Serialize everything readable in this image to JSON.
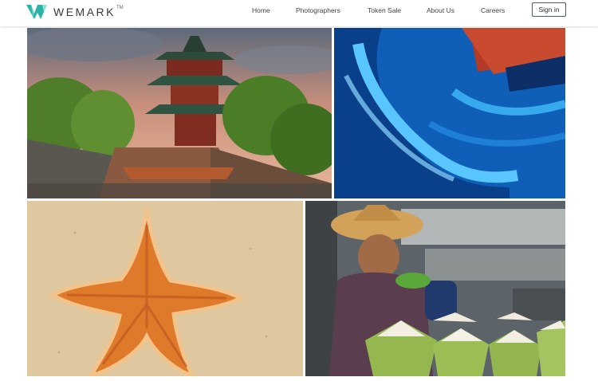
{
  "header": {
    "brand": "WEMARK",
    "brand_mark": "TM",
    "logo_icon": "w-chevron-logo-icon",
    "nav": [
      {
        "label": "Home"
      },
      {
        "label": "Photographers"
      },
      {
        "label": "Token Sale"
      },
      {
        "label": "About Us"
      },
      {
        "label": "Careers"
      }
    ],
    "sign_in_label": "Sign in"
  },
  "gallery": {
    "photos": [
      {
        "subject": "pagoda-temple"
      },
      {
        "subject": "boat-reflection-water"
      },
      {
        "subject": "starfish-on-sand"
      },
      {
        "subject": "coconut-vendor"
      }
    ]
  },
  "colors": {
    "brand_teal": "#2bb3a8",
    "nav_text": "#444444",
    "button_border": "#4a5a66"
  }
}
